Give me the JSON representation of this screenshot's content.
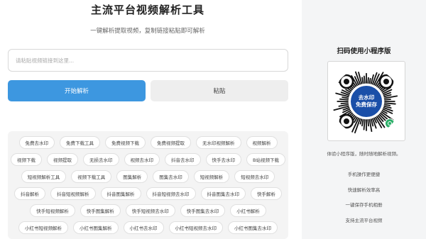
{
  "main": {
    "title": "主流平台视频解析工具",
    "subtitle": "一键解析提取视频，复制链接粘贴即可解析",
    "input_placeholder": "请粘贴视频链接到这里...",
    "start_button": "开始解析",
    "paste_button": "粘贴"
  },
  "tags": [
    [
      "免费去水印",
      "免费下载工具",
      "免费视频下载",
      "免费视频提取",
      "无水印视频解析",
      "视频解析"
    ],
    [
      "视频下载",
      "视频提取",
      "无损去水印",
      "视频去水印",
      "抖音去水印",
      "快手去水印",
      "B站视频下载"
    ],
    [
      "短视频解析工具",
      "视频下载工具",
      "图集解析",
      "图集去水印",
      "短视频解析",
      "短视频去水印"
    ],
    [
      "抖音解析",
      "抖音短视频解析",
      "抖音图集解析",
      "抖音短视频去水印",
      "抖音图集去水印",
      "快手解析"
    ],
    [
      "快手短视频解析",
      "快手图集解析",
      "快手短视频去水印",
      "快手图集去水印",
      "小红书解析"
    ],
    [
      "小红书短视频解析",
      "小红书图集解析",
      "小红书去水印",
      "小红书短视频去水印",
      "小红书图集去水印"
    ]
  ],
  "sidebar": {
    "title": "扫码使用小程序版",
    "qr_text_1": "去水印",
    "qr_text_2": "免费保存",
    "description": "体验小程序版，随时随地解析视频。",
    "features": [
      "手机操作更便捷",
      "快速解析效率高",
      "一键保存手机相册",
      "支持主流平台视频"
    ]
  },
  "colors": {
    "accent": "#3d97e0",
    "qr_center": "#1a4fa8",
    "wechat_green": "#2aae67"
  }
}
